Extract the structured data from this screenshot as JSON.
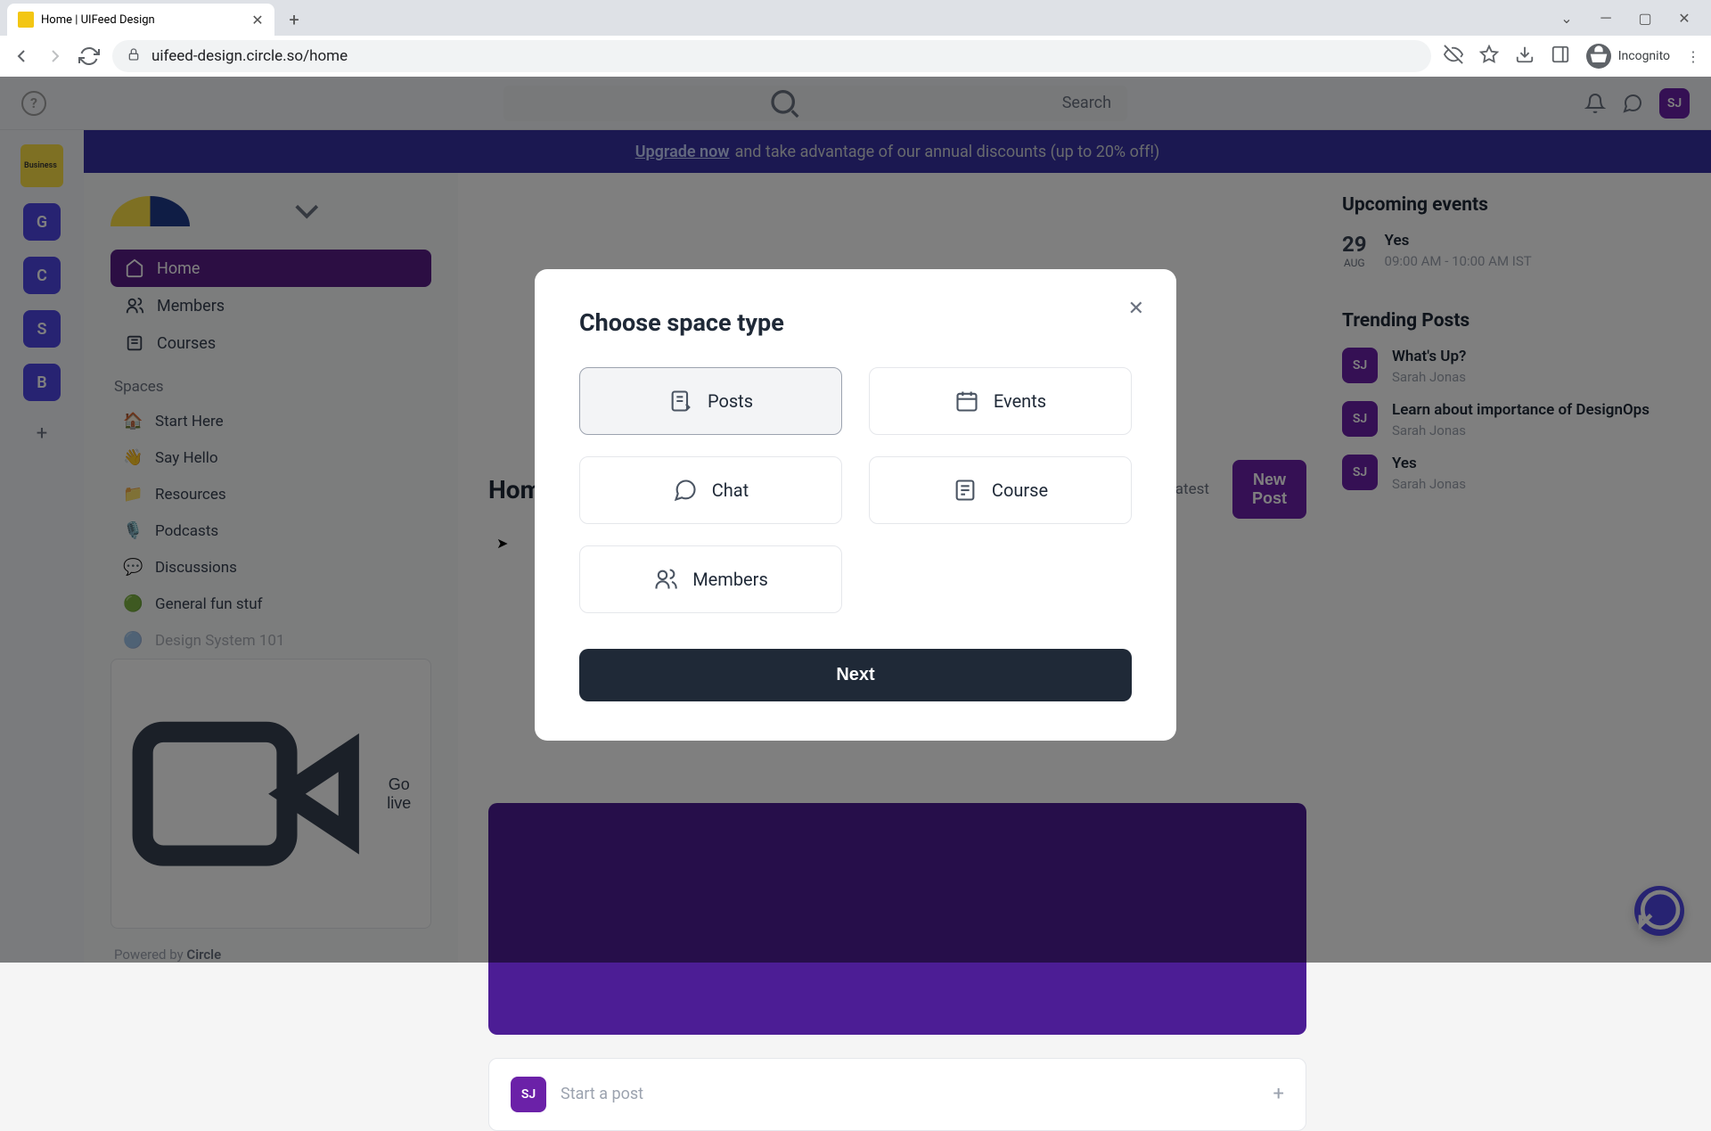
{
  "browser": {
    "tab_title": "Home | UIFeed Design",
    "url": "uifeed-design.circle.so/home",
    "incognito_label": "Incognito"
  },
  "header": {
    "search_placeholder": "Search"
  },
  "banner": {
    "link_text": "Upgrade now",
    "text": " and take advantage of our annual discounts (up to 20% off!)"
  },
  "rail": {
    "business_label": "Business",
    "workspaces": [
      {
        "letter": "G",
        "color": "#4f46e5"
      },
      {
        "letter": "C",
        "color": "#4f46e5"
      },
      {
        "letter": "S",
        "color": "#4f46e5"
      },
      {
        "letter": "B",
        "color": "#4f46e5"
      }
    ]
  },
  "sidebar": {
    "nav": [
      {
        "label": "Home",
        "active": true
      },
      {
        "label": "Members",
        "active": false
      },
      {
        "label": "Courses",
        "active": false
      }
    ],
    "spaces_label": "Spaces",
    "spaces": [
      {
        "emoji": "🏠",
        "label": "Start Here"
      },
      {
        "emoji": "👋",
        "label": "Say Hello"
      },
      {
        "emoji": "📁",
        "label": "Resources"
      },
      {
        "emoji": "🎙️",
        "label": "Podcasts"
      },
      {
        "emoji": "💬",
        "label": "Discussions"
      },
      {
        "emoji": "🟢",
        "label": "General fun stuf"
      },
      {
        "emoji": "🔵",
        "label": "Design System 101"
      }
    ],
    "golive_label": "Go live",
    "powered_prefix": "Powered by ",
    "powered_brand": "Circle"
  },
  "feed": {
    "title": "Home",
    "sort_label": "Latest",
    "new_post_label": "New Post",
    "start_post_placeholder": "Start a post",
    "avatar_initials": "SJ"
  },
  "right": {
    "upcoming_title": "Upcoming events",
    "event": {
      "day": "29",
      "month": "AUG",
      "title": "Yes",
      "time": "09:00 AM - 10:00 AM IST"
    },
    "trending_title": "Trending Posts",
    "posts": [
      {
        "title": "What's Up?",
        "author": "Sarah Jonas"
      },
      {
        "title": "Learn about importance of DesignOps",
        "author": "Sarah Jonas"
      },
      {
        "title": "Yes",
        "author": "Sarah Jonas"
      }
    ]
  },
  "modal": {
    "title": "Choose space type",
    "types": {
      "posts": "Posts",
      "events": "Events",
      "chat": "Chat",
      "course": "Course",
      "members": "Members"
    },
    "next_label": "Next"
  }
}
